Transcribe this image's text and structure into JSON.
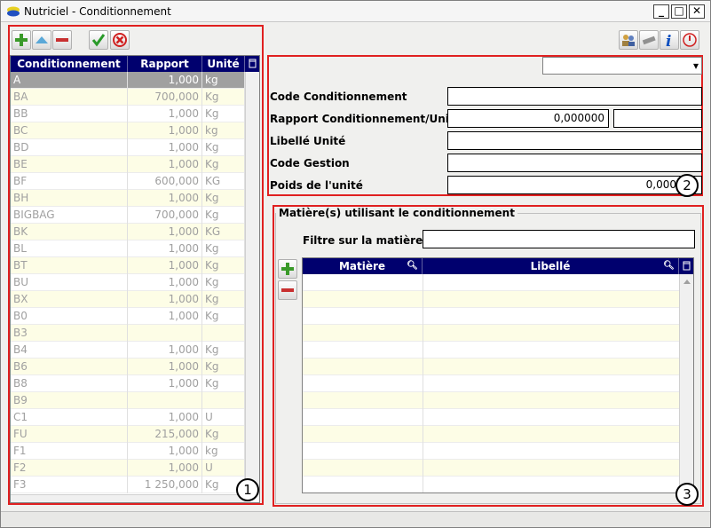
{
  "window": {
    "title": "Nutriciel - Conditionnement"
  },
  "left_toolbar": {
    "icons": [
      "plus-icon",
      "up-icon",
      "minus-icon",
      "check-icon",
      "cancel-icon"
    ]
  },
  "left_grid": {
    "columns": [
      "Conditionnement",
      "Rapport",
      "Unité"
    ],
    "rows": [
      [
        "A",
        "1,000",
        "kg"
      ],
      [
        "BA",
        "700,000",
        "Kg"
      ],
      [
        "BB",
        "1,000",
        "Kg"
      ],
      [
        "BC",
        "1,000",
        "kg"
      ],
      [
        "BD",
        "1,000",
        "Kg"
      ],
      [
        "BE",
        "1,000",
        "Kg"
      ],
      [
        "BF",
        "600,000",
        "KG"
      ],
      [
        "BH",
        "1,000",
        "Kg"
      ],
      [
        "BIGBAG",
        "700,000",
        "Kg"
      ],
      [
        "BK",
        "1,000",
        "KG"
      ],
      [
        "BL",
        "1,000",
        "Kg"
      ],
      [
        "BT",
        "1,000",
        "Kg"
      ],
      [
        "BU",
        "1,000",
        "Kg"
      ],
      [
        "BX",
        "1,000",
        "Kg"
      ],
      [
        "B0",
        "1,000",
        "Kg"
      ],
      [
        "B3",
        "",
        ""
      ],
      [
        "B4",
        "1,000",
        "Kg"
      ],
      [
        "B6",
        "1,000",
        "Kg"
      ],
      [
        "B8",
        "1,000",
        "Kg"
      ],
      [
        "B9",
        "",
        ""
      ],
      [
        "C1",
        "1,000",
        "U"
      ],
      [
        "FU",
        "215,000",
        "Kg"
      ],
      [
        "F1",
        "1,000",
        "kg"
      ],
      [
        "F2",
        "1,000",
        "U"
      ],
      [
        "F3",
        "1 250,000",
        "Kg"
      ]
    ]
  },
  "right_toolbar": {
    "icons": [
      "people-icon",
      "tools-icon",
      "info-icon",
      "power-icon"
    ]
  },
  "form": {
    "dropdown_value": "",
    "code_conditionnement": {
      "label": "Code Conditionnement",
      "value": ""
    },
    "rapport": {
      "label": "Rapport Conditionnement/Unité",
      "value": "0,000000",
      "unit": ""
    },
    "libelle_unite": {
      "label": "Libellé Unité",
      "value": ""
    },
    "code_gestion": {
      "label": "Code Gestion",
      "value": ""
    },
    "poids": {
      "label": "Poids de l'unité",
      "value": "0,000"
    }
  },
  "matieres": {
    "group_title": "Matière(s) utilisant le conditionnement",
    "filter_label": "Filtre sur la matière",
    "filter_value": "",
    "columns": [
      "Matière",
      "Libellé"
    ],
    "row_count": 13
  },
  "badges": [
    "1",
    "2",
    "3"
  ],
  "colors": {
    "accent": "#00006e",
    "highlight_box": "#e02020",
    "alt_row": "#fdfde6"
  }
}
